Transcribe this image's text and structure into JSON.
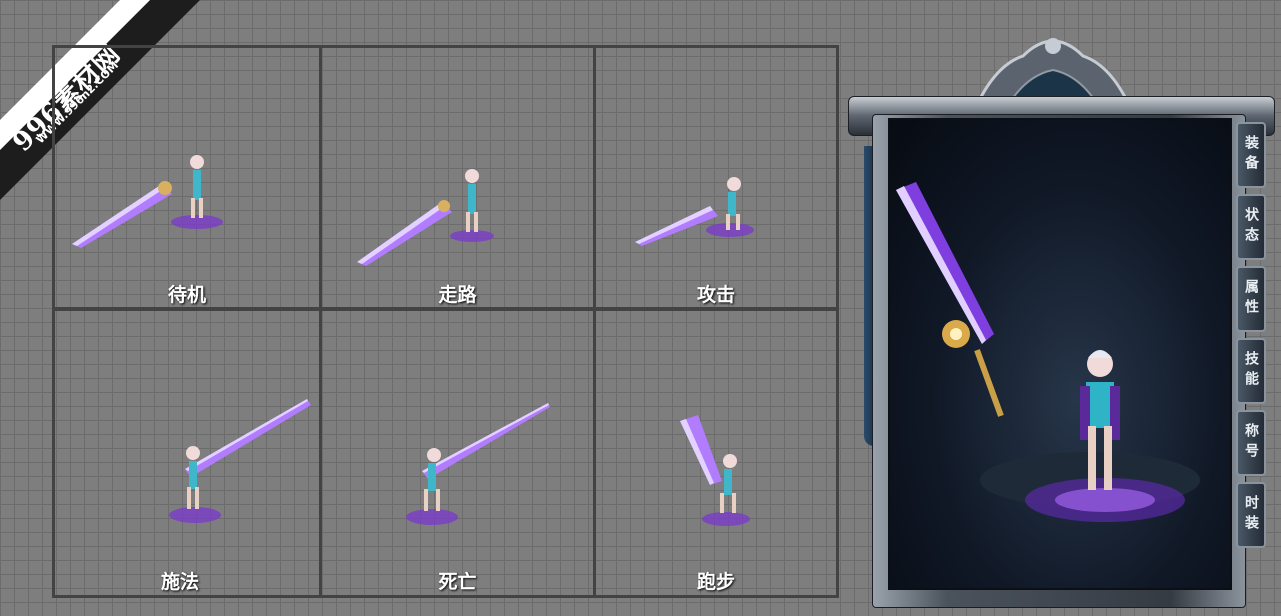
{
  "watermark": {
    "brand": "996素材网",
    "url": "WWW.996n2.COM"
  },
  "frames": [
    {
      "id": "idle",
      "label": "待机"
    },
    {
      "id": "walk",
      "label": "走路"
    },
    {
      "id": "attack",
      "label": "攻击"
    },
    {
      "id": "cast",
      "label": "施法"
    },
    {
      "id": "death",
      "label": "死亡"
    },
    {
      "id": "run",
      "label": "跑步"
    }
  ],
  "panel": {
    "tabs": [
      "装备",
      "状态",
      "属性",
      "技能",
      "称号",
      "时装"
    ]
  },
  "colors": {
    "grid_bg": "#7e7e7e",
    "frame_border": "#434343",
    "blade_glow": "#8a3cff",
    "panel_dark": "#101826"
  }
}
